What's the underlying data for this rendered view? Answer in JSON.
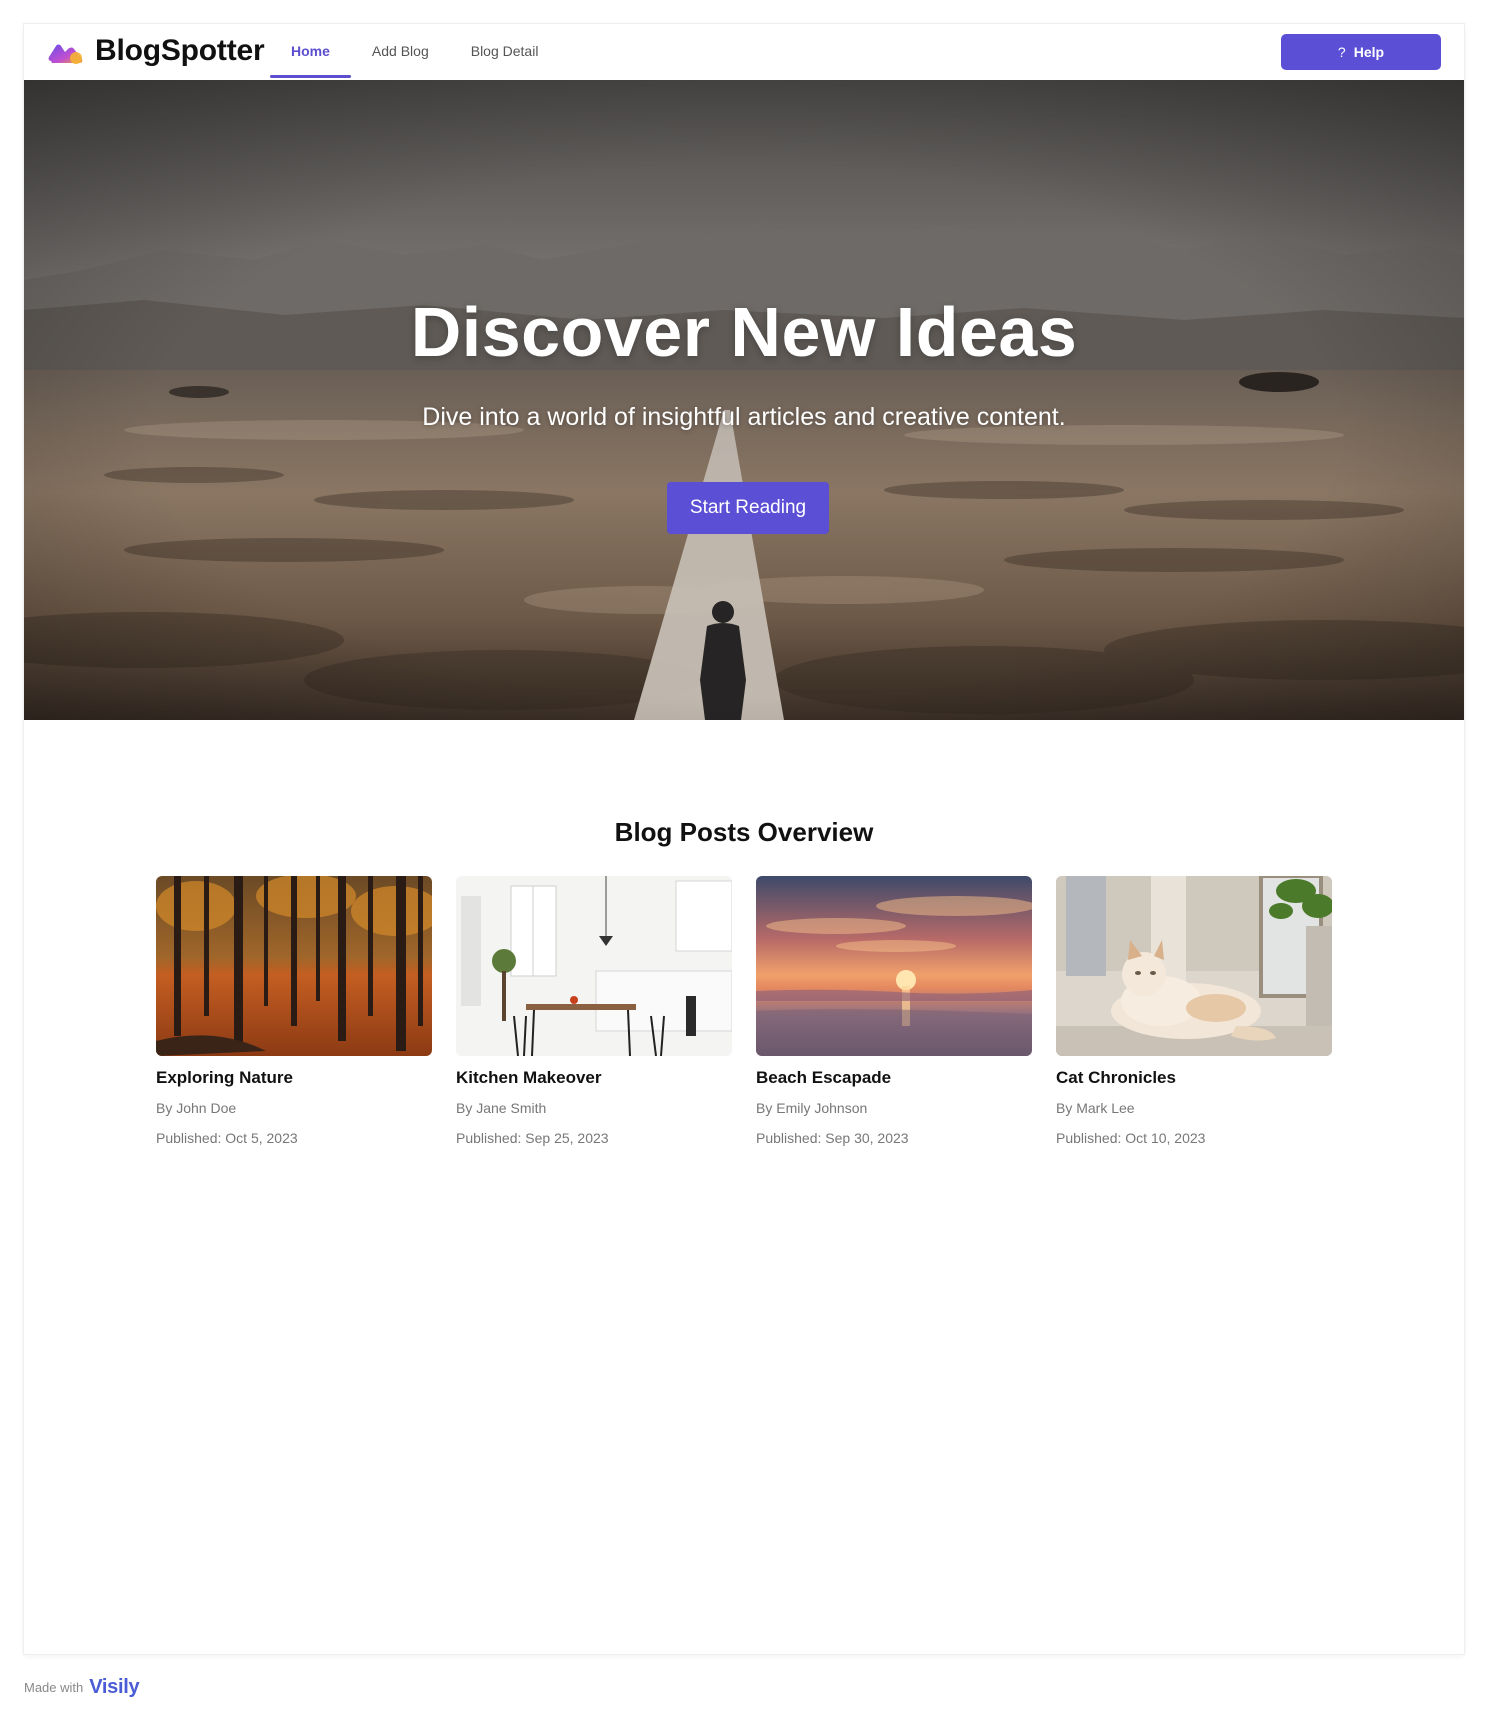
{
  "header": {
    "brand": "BlogSpotter",
    "nav": [
      "Home",
      "Add Blog",
      "Blog Detail"
    ],
    "active_nav": "Home",
    "help_label": "Help",
    "help_icon": "question-mark-icon"
  },
  "hero": {
    "title": "Discover New Ideas",
    "subtitle": "Dive into a world of insightful articles and creative content.",
    "cta_label": "Start Reading"
  },
  "posts": {
    "title": "Blog Posts Overview",
    "items": [
      {
        "title": "Exploring Nature",
        "author": "By John Doe",
        "date": "Published: Oct 5, 2023"
      },
      {
        "title": "Kitchen Makeover",
        "author": "By Jane Smith",
        "date": "Published: Sep 25, 2023"
      },
      {
        "title": "Beach Escapade",
        "author": "By Emily Johnson",
        "date": "Published: Sep 30, 2023"
      },
      {
        "title": "Cat Chronicles",
        "author": "By Mark Lee",
        "date": "Published: Oct 10, 2023"
      }
    ]
  },
  "footer": {
    "made_with": "Made with",
    "visily": "Visily"
  },
  "colors": {
    "accent": "#5b4fd6",
    "text": "#111111",
    "muted": "#777777"
  }
}
